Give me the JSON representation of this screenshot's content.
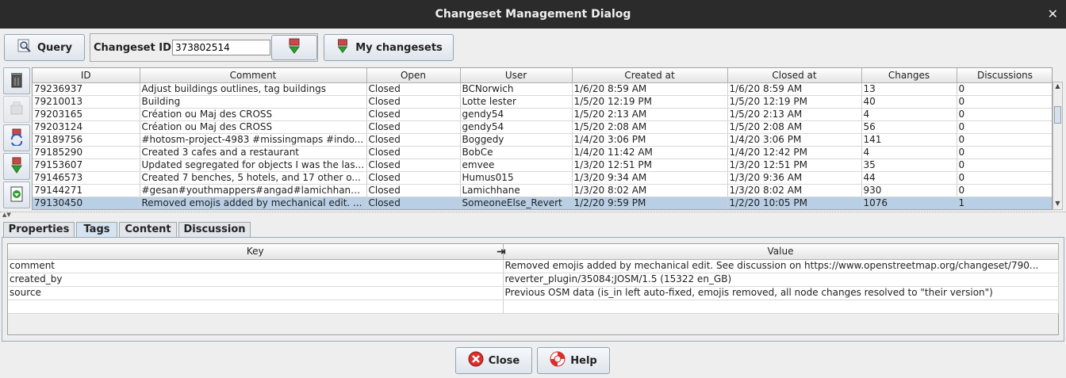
{
  "window": {
    "title": "Changeset Management Dialog",
    "close_glyph": "✕"
  },
  "toolbar": {
    "query_label": "Query",
    "changeset_id_label": "Changeset ID:",
    "changeset_id_value": "373802514",
    "my_changesets_label": "My changesets"
  },
  "table": {
    "columns": [
      "ID",
      "Comment",
      "Open",
      "User",
      "Created at",
      "Closed at",
      "Changes",
      "Discussions"
    ],
    "rows": [
      [
        "79236937",
        "Adjust buildings outlines, tag buildings",
        "Closed",
        "BCNorwich",
        "1/6/20 8:59 AM",
        "1/6/20 8:59 AM",
        "13",
        "0"
      ],
      [
        "79210013",
        "Building",
        "Closed",
        "Lotte lester",
        "1/5/20 12:19 PM",
        "1/5/20 12:19 PM",
        "40",
        "0"
      ],
      [
        "79203165",
        "Création ou Maj des CROSS",
        "Closed",
        "gendy54",
        "1/5/20 2:13 AM",
        "1/5/20 2:13 AM",
        "4",
        "0"
      ],
      [
        "79203124",
        "Création ou Maj des CROSS",
        "Closed",
        "gendy54",
        "1/5/20 2:08 AM",
        "1/5/20 2:08 AM",
        "56",
        "0"
      ],
      [
        "79189756",
        "#hotosm-project-4983 #missingmaps #indo...",
        "Closed",
        "Boggedy",
        "1/4/20 3:06 PM",
        "1/4/20 3:06 PM",
        "141",
        "0"
      ],
      [
        "79185290",
        "Created 3 cafes and a restaurant",
        "Closed",
        "BobCe",
        "1/4/20 11:42 AM",
        "1/4/20 12:42 PM",
        "4",
        "0"
      ],
      [
        "79153607",
        "Updated segregated for objects I was the las...",
        "Closed",
        "emvee",
        "1/3/20 12:51 PM",
        "1/3/20 12:51 PM",
        "35",
        "0"
      ],
      [
        "79146573",
        "Created 7 benches, 5 hotels, and 17 other o...",
        "Closed",
        "Humus015",
        "1/3/20 9:34 AM",
        "1/3/20 9:36 AM",
        "44",
        "0"
      ],
      [
        "79144271",
        "#gesan#youthmappers#angad#lamichhane...",
        "Closed",
        "Lamichhane",
        "1/3/20 8:02 AM",
        "1/3/20 8:02 AM",
        "930",
        "0"
      ],
      [
        "79130450",
        "Removed emojis added by mechanical edit. ...",
        "Closed",
        "SomeoneElse_Revert",
        "1/2/20 9:59 PM",
        "1/2/20 10:05 PM",
        "1076",
        "1"
      ]
    ],
    "selected_index": 9
  },
  "tabs": [
    {
      "label": "Properties"
    },
    {
      "label": "Tags"
    },
    {
      "label": "Content"
    },
    {
      "label": "Discussion"
    }
  ],
  "active_tab": "Tags",
  "tags": {
    "columns": [
      "Key",
      "Value"
    ],
    "rows": [
      [
        "comment",
        "Removed emojis added by mechanical edit.  See discussion on https://www.openstreetmap.org/changeset/790..."
      ],
      [
        "created_by",
        "reverter_plugin/35084;JOSM/1.5 (15322 en_GB)"
      ],
      [
        "source",
        "Previous OSM data (is_in left auto-fixed, emojis removed, all node changes resolved to \"their version\")"
      ],
      [
        "",
        ""
      ]
    ]
  },
  "footer": {
    "close_label": "Close",
    "help_label": "Help"
  },
  "colors": {
    "titlebar": "#2b2b2b",
    "selection": "#b8cfe5",
    "close_icon": "#d9302a",
    "download_icon": "#2e9e2e"
  }
}
